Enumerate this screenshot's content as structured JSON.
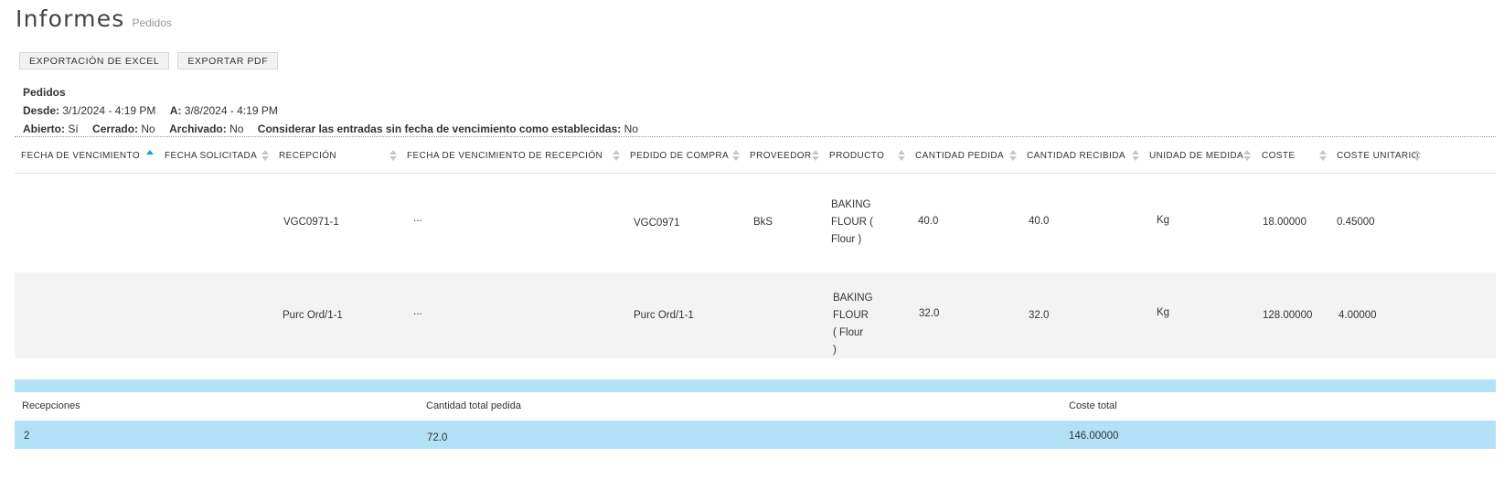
{
  "page": {
    "title": "Informes",
    "subtitle": "Pedidos"
  },
  "toolbar": {
    "excel_label": "EXPORTACIÓN DE EXCEL",
    "pdf_label": "EXPORTAR PDF"
  },
  "filters": {
    "heading": "Pedidos",
    "from_label": "Desde:",
    "from_value": "3/1/2024 - 4:19 PM",
    "to_label": "A:",
    "to_value": "3/8/2024 - 4:19 PM",
    "open_label": "Abierto:",
    "open_value": "Sí",
    "closed_label": "Cerrado:",
    "closed_value": "No",
    "archived_label": "Archivado:",
    "archived_value": "No",
    "consider_label": "Considerar las entradas sin fecha de vencimiento como establecidas:",
    "consider_value": "No"
  },
  "table": {
    "headers": {
      "due_date": "FECHA DE VENCIMIENTO",
      "requested_date": "FECHA SOLICITADA",
      "reception": "RECEPCIÓN",
      "reception_due": "FECHA DE VENCIMIENTO DE RECEPCIÓN",
      "purchase_order": "PEDIDO DE COMPRA",
      "supplier": "PROVEEDOR",
      "product": "PRODUCTO",
      "qty_ordered": "CANTIDAD PEDIDA",
      "qty_received": "CANTIDAD RECIBIDA",
      "unit": "UNIDAD DE MEDIDA",
      "cost": "COSTE",
      "unit_cost": "COSTE UNITARIO"
    },
    "sorted_column": "due_date",
    "sort_direction": "ascending",
    "rows": [
      {
        "reception": "VGC0971-1",
        "reception_due": "...",
        "purchase_order": "VGC0971",
        "supplier": "BkS",
        "product_lines": [
          "BAKING",
          "FLOUR (",
          "Flour )"
        ],
        "qty_ordered": "40.0",
        "qty_received": "40.0",
        "unit": "Kg",
        "cost": "18.00000",
        "unit_cost": "0.45000"
      },
      {
        "reception": "Purc Ord/1-1",
        "reception_due": "...",
        "purchase_order": "Purc Ord/1-1",
        "supplier": "",
        "product_lines": [
          "BAKING",
          "FLOUR",
          "( Flour",
          ")"
        ],
        "qty_ordered": "32.0",
        "qty_received": "32.0",
        "unit": "Kg",
        "cost": "128.00000",
        "unit_cost": "4.00000"
      }
    ]
  },
  "summary": {
    "receptions_label": "Recepciones",
    "receptions_value": "2",
    "total_qty_label": "Cantidad total pedida",
    "total_qty_value": "72.0",
    "total_cost_label": "Coste total",
    "total_cost_value": "146.00000"
  },
  "colors": {
    "accent": "#1a9bd7",
    "summary_bg": "#b3e1f8",
    "row_alt_bg": "#f3f3f3"
  }
}
